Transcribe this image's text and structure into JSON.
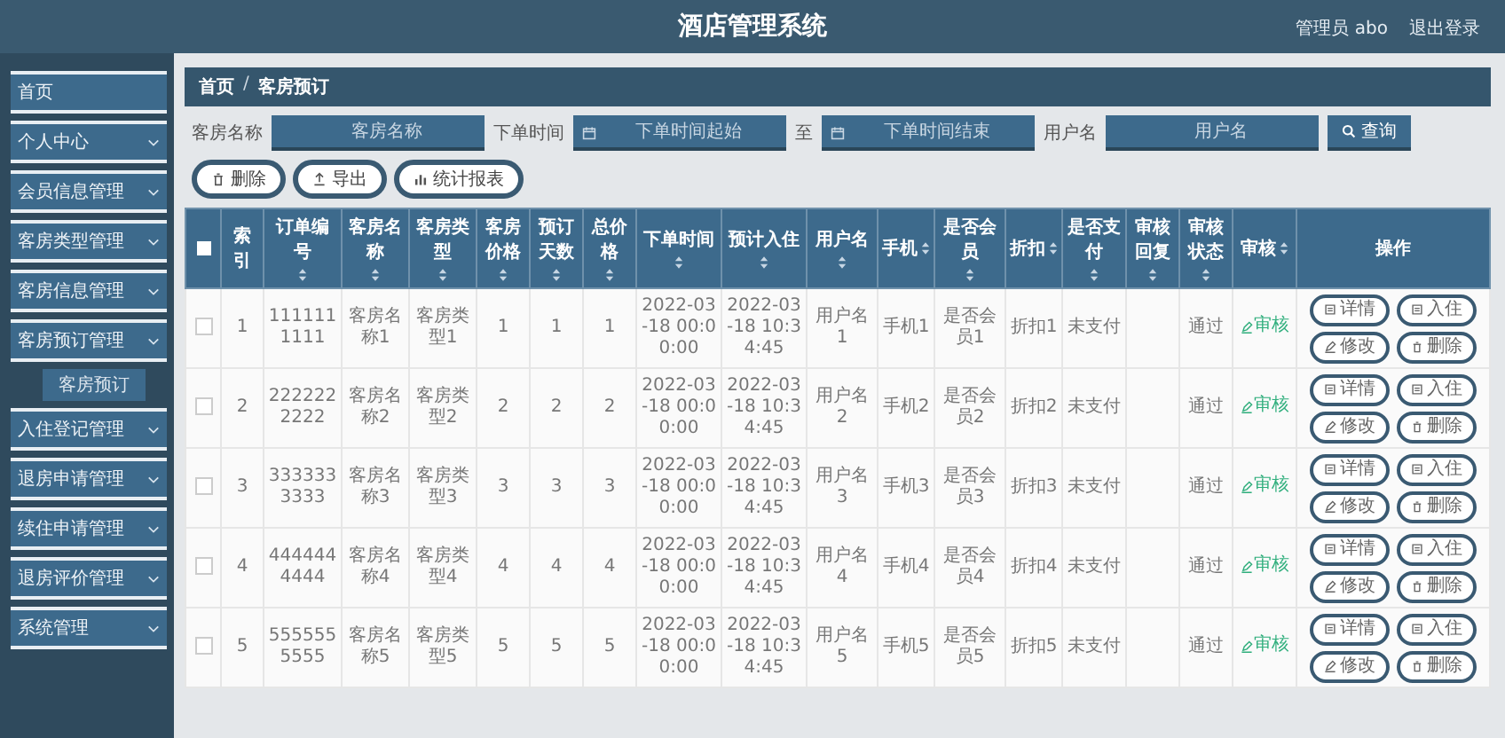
{
  "header": {
    "title": "酒店管理系统",
    "user": "管理员 abo",
    "logout": "退出登录"
  },
  "sidebar": {
    "items": [
      {
        "label": "首页",
        "expandable": false
      },
      {
        "label": "个人中心",
        "expandable": true
      },
      {
        "label": "会员信息管理",
        "expandable": true
      },
      {
        "label": "客房类型管理",
        "expandable": true
      },
      {
        "label": "客房信息管理",
        "expandable": true
      },
      {
        "label": "客房预订管理",
        "expandable": true,
        "children": [
          {
            "label": "客房预订",
            "selected": true
          }
        ]
      },
      {
        "label": "入住登记管理",
        "expandable": true
      },
      {
        "label": "退房申请管理",
        "expandable": true
      },
      {
        "label": "续住申请管理",
        "expandable": true
      },
      {
        "label": "退房评价管理",
        "expandable": true
      },
      {
        "label": "系统管理",
        "expandable": true
      }
    ]
  },
  "breadcrumb": {
    "items": [
      "首页",
      "客房预订"
    ],
    "separator": "/"
  },
  "search": {
    "fields": [
      {
        "label": "客房名称",
        "placeholder": "客房名称",
        "kind": "text"
      },
      {
        "label": "下单时间",
        "placeholder": "下单时间起始",
        "kind": "date"
      },
      {
        "label": "至",
        "placeholder": "下单时间结束",
        "kind": "date"
      },
      {
        "label": "用户名",
        "placeholder": "用户名",
        "kind": "text"
      }
    ],
    "button": "查询"
  },
  "actions": [
    {
      "label": "删除",
      "kind": "delete"
    },
    {
      "label": "导出",
      "kind": "export"
    },
    {
      "label": "统计报表",
      "kind": "chart"
    }
  ],
  "table": {
    "select_all": {
      "checked": false
    },
    "columns": [
      {
        "label": "索引",
        "sortable": false
      },
      {
        "label": "订单编号",
        "sortable": true
      },
      {
        "label": "客房名称",
        "sortable": true
      },
      {
        "label": "客房类型",
        "sortable": true
      },
      {
        "label": "客房价格",
        "sortable": true
      },
      {
        "label": "预订天数",
        "sortable": true
      },
      {
        "label": "总价格",
        "sortable": true
      },
      {
        "label": "下单时间",
        "sortable": true
      },
      {
        "label": "预计入住",
        "sortable": true
      },
      {
        "label": "用户名",
        "sortable": true
      },
      {
        "label": "手机",
        "sortable": true
      },
      {
        "label": "是否会员",
        "sortable": true
      },
      {
        "label": "折扣",
        "sortable": true
      },
      {
        "label": "是否支付",
        "sortable": true
      },
      {
        "label": "审核回复",
        "sortable": true
      },
      {
        "label": "审核状态",
        "sortable": true
      },
      {
        "label": "审核",
        "sortable": true
      },
      {
        "label": "操作",
        "sortable": false
      }
    ],
    "rows": [
      {
        "checked": false,
        "cells": [
          "1",
          "1111111111",
          "客房名称1",
          "客房类型1",
          "1",
          "1",
          "1",
          "2022-03-18 00:00:00",
          "2022-03-18 10:34:45",
          "用户名1",
          "手机1",
          "是否会员1",
          "折扣1",
          "未支付",
          "",
          "通过"
        ],
        "review": "审核",
        "buttons": [
          {
            "label": "详情",
            "kind": "detail"
          },
          {
            "label": "入住",
            "kind": "checkin"
          },
          {
            "label": "修改",
            "kind": "edit"
          },
          {
            "label": "删除",
            "kind": "delete"
          }
        ]
      },
      {
        "checked": false,
        "cells": [
          "2",
          "2222222222",
          "客房名称2",
          "客房类型2",
          "2",
          "2",
          "2",
          "2022-03-18 00:00:00",
          "2022-03-18 10:34:45",
          "用户名2",
          "手机2",
          "是否会员2",
          "折扣2",
          "未支付",
          "",
          "通过"
        ],
        "review": "审核",
        "buttons": [
          {
            "label": "详情",
            "kind": "detail"
          },
          {
            "label": "入住",
            "kind": "checkin"
          },
          {
            "label": "修改",
            "kind": "edit"
          },
          {
            "label": "删除",
            "kind": "delete"
          }
        ]
      },
      {
        "checked": false,
        "cells": [
          "3",
          "3333333333",
          "客房名称3",
          "客房类型3",
          "3",
          "3",
          "3",
          "2022-03-18 00:00:00",
          "2022-03-18 10:34:45",
          "用户名3",
          "手机3",
          "是否会员3",
          "折扣3",
          "未支付",
          "",
          "通过"
        ],
        "review": "审核",
        "buttons": [
          {
            "label": "详情",
            "kind": "detail"
          },
          {
            "label": "入住",
            "kind": "checkin"
          },
          {
            "label": "修改",
            "kind": "edit"
          },
          {
            "label": "删除",
            "kind": "delete"
          }
        ]
      },
      {
        "checked": false,
        "cells": [
          "4",
          "4444444444",
          "客房名称4",
          "客房类型4",
          "4",
          "4",
          "4",
          "2022-03-18 00:00:00",
          "2022-03-18 10:34:45",
          "用户名4",
          "手机4",
          "是否会员4",
          "折扣4",
          "未支付",
          "",
          "通过"
        ],
        "review": "审核",
        "buttons": [
          {
            "label": "详情",
            "kind": "detail"
          },
          {
            "label": "入住",
            "kind": "checkin"
          },
          {
            "label": "修改",
            "kind": "edit"
          },
          {
            "label": "删除",
            "kind": "delete"
          }
        ]
      },
      {
        "checked": false,
        "cells": [
          "5",
          "5555555555",
          "客房名称5",
          "客房类型5",
          "5",
          "5",
          "5",
          "2022-03-18 00:00:00",
          "2022-03-18 10:34:45",
          "用户名5",
          "手机5",
          "是否会员5",
          "折扣5",
          "未支付",
          "",
          "通过"
        ],
        "review": "审核",
        "buttons": [
          {
            "label": "详情",
            "kind": "detail"
          },
          {
            "label": "入住",
            "kind": "checkin"
          },
          {
            "label": "修改",
            "kind": "edit"
          },
          {
            "label": "删除",
            "kind": "delete"
          }
        ]
      }
    ]
  }
}
